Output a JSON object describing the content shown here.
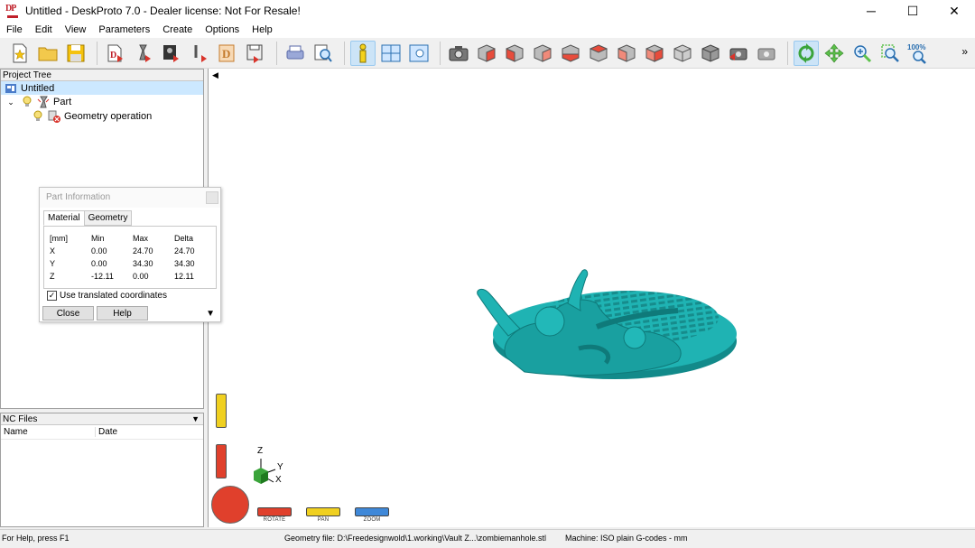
{
  "window": {
    "title": "Untitled - DeskProto 7.0 - Dealer license: Not For Resale!",
    "logo_text": "DP",
    "minimize": "─",
    "maximize": "☐",
    "close": "✕"
  },
  "menu": [
    "File",
    "Edit",
    "View",
    "Parameters",
    "Create",
    "Options",
    "Help"
  ],
  "toolbar": {
    "zoom_label": "100%",
    "more": "»"
  },
  "project_tree": {
    "header": "Project Tree",
    "root": "Untitled",
    "part": "Part",
    "operation": "Geometry operation"
  },
  "nc_files": {
    "header": "NC Files",
    "col_name": "Name",
    "col_date": "Date"
  },
  "dialog": {
    "title": "Part Information",
    "tab_material": "Material",
    "tab_geometry": "Geometry",
    "head": [
      "[mm]",
      "Min",
      "Max",
      "Delta"
    ],
    "rows": [
      [
        "X",
        "0.00",
        "24.70",
        "24.70"
      ],
      [
        "Y",
        "0.00",
        "34.30",
        "34.30"
      ],
      [
        "Z",
        "-12.11",
        "0.00",
        "12.11"
      ]
    ],
    "checkbox_label": "Use translated coordinates",
    "checkbox_checked": true,
    "close_button": "Close",
    "help_button": "Help"
  },
  "viewport": {
    "axis_z": "Z",
    "axis_y": "Y",
    "axis_x": "X",
    "rotate": "ROTATE",
    "pan": "PAN",
    "zoom": "ZOOM",
    "model_color": "#1fb3b3"
  },
  "status": {
    "help": "For Help, press F1",
    "geometry_file": "Geometry file: D:\\Freedesignwold\\1.working\\Vault Z...\\zombiemanhole.stl",
    "machine": "Machine: ISO plain G-codes - mm"
  }
}
